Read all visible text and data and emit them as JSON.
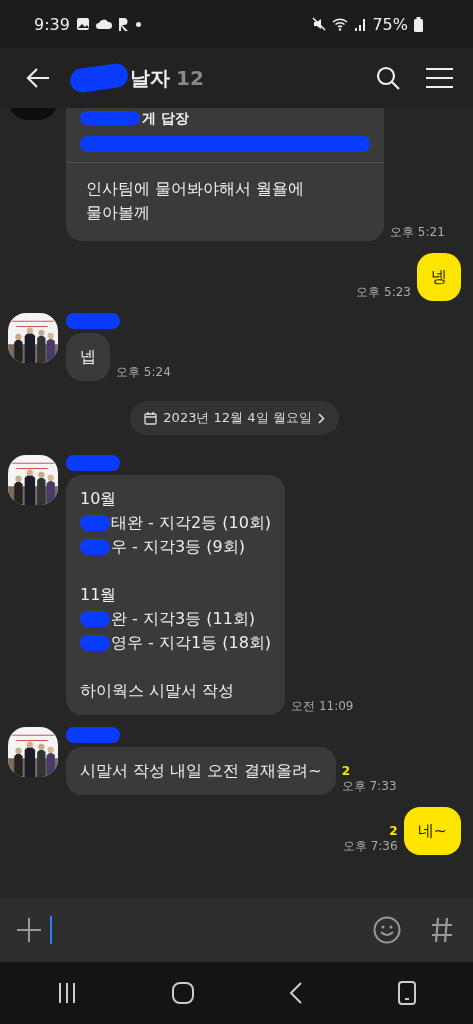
{
  "status_bar": {
    "time": "9:39",
    "battery": "75%"
  },
  "header": {
    "title": "날자",
    "title_redacted": true,
    "count": "12"
  },
  "messages": [
    {
      "kind": "reply",
      "avatar": true,
      "quote_title": "게 답장",
      "quote_redacted": true,
      "lines": [
        "인사팀에 물어봐야해서 월욜에",
        "물아볼께"
      ],
      "time": "오후 5:21"
    },
    {
      "kind": "out",
      "lines": [
        "넹"
      ],
      "time": "오후 5:23"
    },
    {
      "kind": "in",
      "avatar": true,
      "name_redacted": true,
      "lines": [
        "넵"
      ],
      "time": "오후 5:24"
    },
    {
      "kind": "date",
      "text": "2023년 12월 4일 월요일"
    },
    {
      "kind": "list",
      "avatar": true,
      "name_redacted": true,
      "paragraphs": [
        [
          {
            "text": "10월",
            "redacted": false
          },
          {
            "text": "태완 - 지각2등 (10회)",
            "redacted": true
          },
          {
            "text": "우 - 지각3등 (9회)",
            "redacted": true
          }
        ],
        [
          {
            "text": "11월",
            "redacted": false
          },
          {
            "text": "완 - 지각3등 (11회)",
            "redacted": true
          },
          {
            "text": "영우 - 지각1등 (18회)",
            "redacted": true
          }
        ],
        [
          {
            "text": "하이웍스 시말서 작성",
            "redacted": false
          }
        ]
      ],
      "time": "오전 11:09"
    },
    {
      "kind": "in",
      "avatar": true,
      "name_redacted": true,
      "lines": [
        "시말서 작성 내일 오전 결재올려~"
      ],
      "unread": "2",
      "time": "오후 7:33"
    },
    {
      "kind": "out",
      "lines": [
        "네~"
      ],
      "unread": "2",
      "time": "오후 7:36"
    }
  ]
}
